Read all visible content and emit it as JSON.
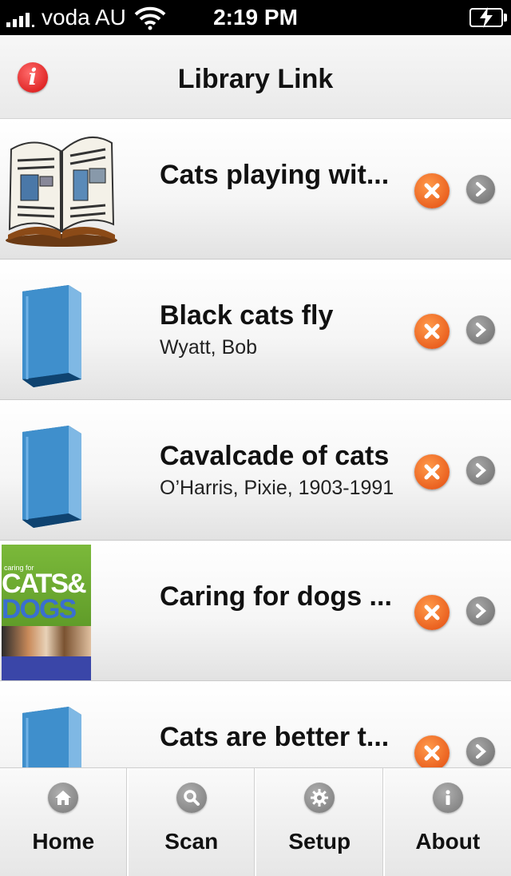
{
  "status_bar": {
    "carrier": "voda AU",
    "time": "2:19 PM"
  },
  "nav": {
    "title": "Library Link",
    "info_icon": "info-icon"
  },
  "items": [
    {
      "title": "Cats playing wit...",
      "author": "",
      "thumbnail": "open-book-icon"
    },
    {
      "title": "Black cats fly",
      "author": "Wyatt, Bob",
      "thumbnail": "blue-book-icon"
    },
    {
      "title": "Cavalcade of cats",
      "author": "O’Harris, Pixie, 1903-1991",
      "thumbnail": "blue-book-icon"
    },
    {
      "title": "Caring for dogs ...",
      "author": "",
      "thumbnail": "cover-image",
      "cover": {
        "top_small": "caring for",
        "line1": "CATS&",
        "line2": "DOGS"
      }
    },
    {
      "title": "Cats are better t...",
      "author": "",
      "thumbnail": "blue-book-icon"
    }
  ],
  "tabs": [
    {
      "label": "Home",
      "icon": "home-icon"
    },
    {
      "label": "Scan",
      "icon": "search-icon"
    },
    {
      "label": "Setup",
      "icon": "gear-icon"
    },
    {
      "label": "About",
      "icon": "info-icon"
    }
  ],
  "colors": {
    "delete": "#e24a0f",
    "chevron": "#7a7a7a",
    "info": "#d40c0c"
  }
}
